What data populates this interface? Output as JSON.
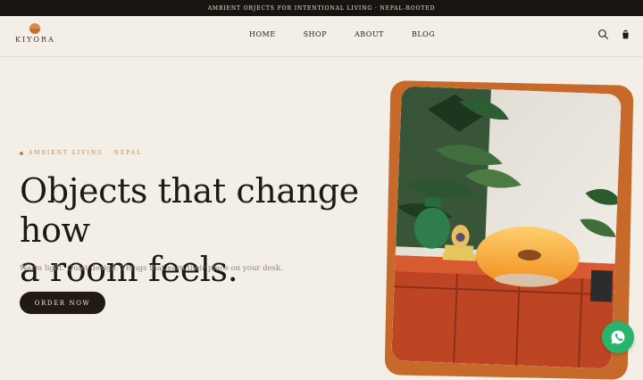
{
  "announcement": "AMBIENT OBJECTS FOR INTENTIONAL LIVING · NEPAL-ROOTED",
  "brand": {
    "name": "KIYORA"
  },
  "nav": {
    "items": [
      {
        "label": "HOME"
      },
      {
        "label": "SHOP"
      },
      {
        "label": "ABOUT"
      },
      {
        "label": "BLOG"
      }
    ]
  },
  "header": {
    "icons": [
      "search-icon",
      "shopping-bag-icon"
    ]
  },
  "hero": {
    "eyebrow": "AMBIENT LIVING · NEPAL",
    "title_line1": "Objects that change how",
    "title_line2": "a room feels.",
    "subtitle": "Warm light. Quiet design. Things that earn their place on your desk.",
    "cta_label": "ORDER NOW"
  },
  "colors": {
    "accent": "#c7692b",
    "dark": "#211915",
    "background": "#f3efe7",
    "whatsapp": "#29b46e"
  },
  "floating": {
    "icon": "whatsapp-icon"
  }
}
